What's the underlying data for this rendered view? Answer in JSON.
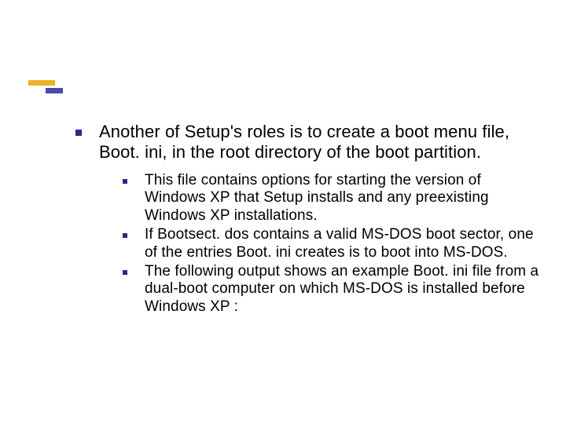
{
  "main": {
    "text": "Another of Setup's roles is to create a boot menu file, Boot. ini, in the root directory of the boot partition."
  },
  "subs": {
    "items": [
      {
        "text": "This file contains options for starting the version of Windows XP that Setup installs and any preexisting Windows XP installations."
      },
      {
        "text": "If Bootsect. dos contains a valid MS-DOS boot sector, one of the entries Boot. ini creates is to boot into MS-DOS."
      },
      {
        "text": "The following output shows an example Boot. ini file from a dual-boot computer on which MS-DOS is installed before Windows XP :"
      }
    ]
  }
}
